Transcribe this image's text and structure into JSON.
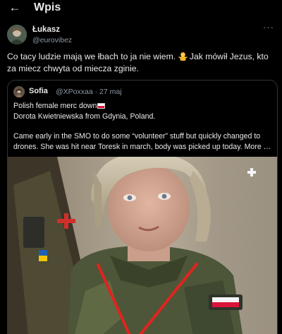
{
  "header": {
    "back_icon": "arrow-left-icon",
    "title": "Wpis"
  },
  "tweet": {
    "author_name": "Łukasz",
    "author_handle": "@eurovibez",
    "text_part1": "Co tacy ludzie mają we łbach to ja nie wiem. ",
    "emoji": "person-shrugging-emoji",
    "text_part2": " Jak mówił Jezus, kto za miecz chwyta od miecza zginie.",
    "more_icon": "more-horizontal-icon"
  },
  "quote": {
    "author_name": "Sofia",
    "meta": "@XPoxxaa · 27 maj",
    "line1": "Polish female merc down",
    "line1_flag": "poland-flag-emoji",
    "line2": "Dorota Kwietniewska from Gdynia, Poland.",
    "line3": "Came early in the SMO to do some “volunteer” stuff but quickly changed to",
    "line4": "drones. She was hit near Toresk in march, body was picked up today. More …"
  },
  "colors": {
    "background": "#000000",
    "text_primary": "#e7e9ea",
    "text_secondary": "#8b98a5",
    "border": "#2f3336",
    "annotation_red": "#e0241e"
  }
}
